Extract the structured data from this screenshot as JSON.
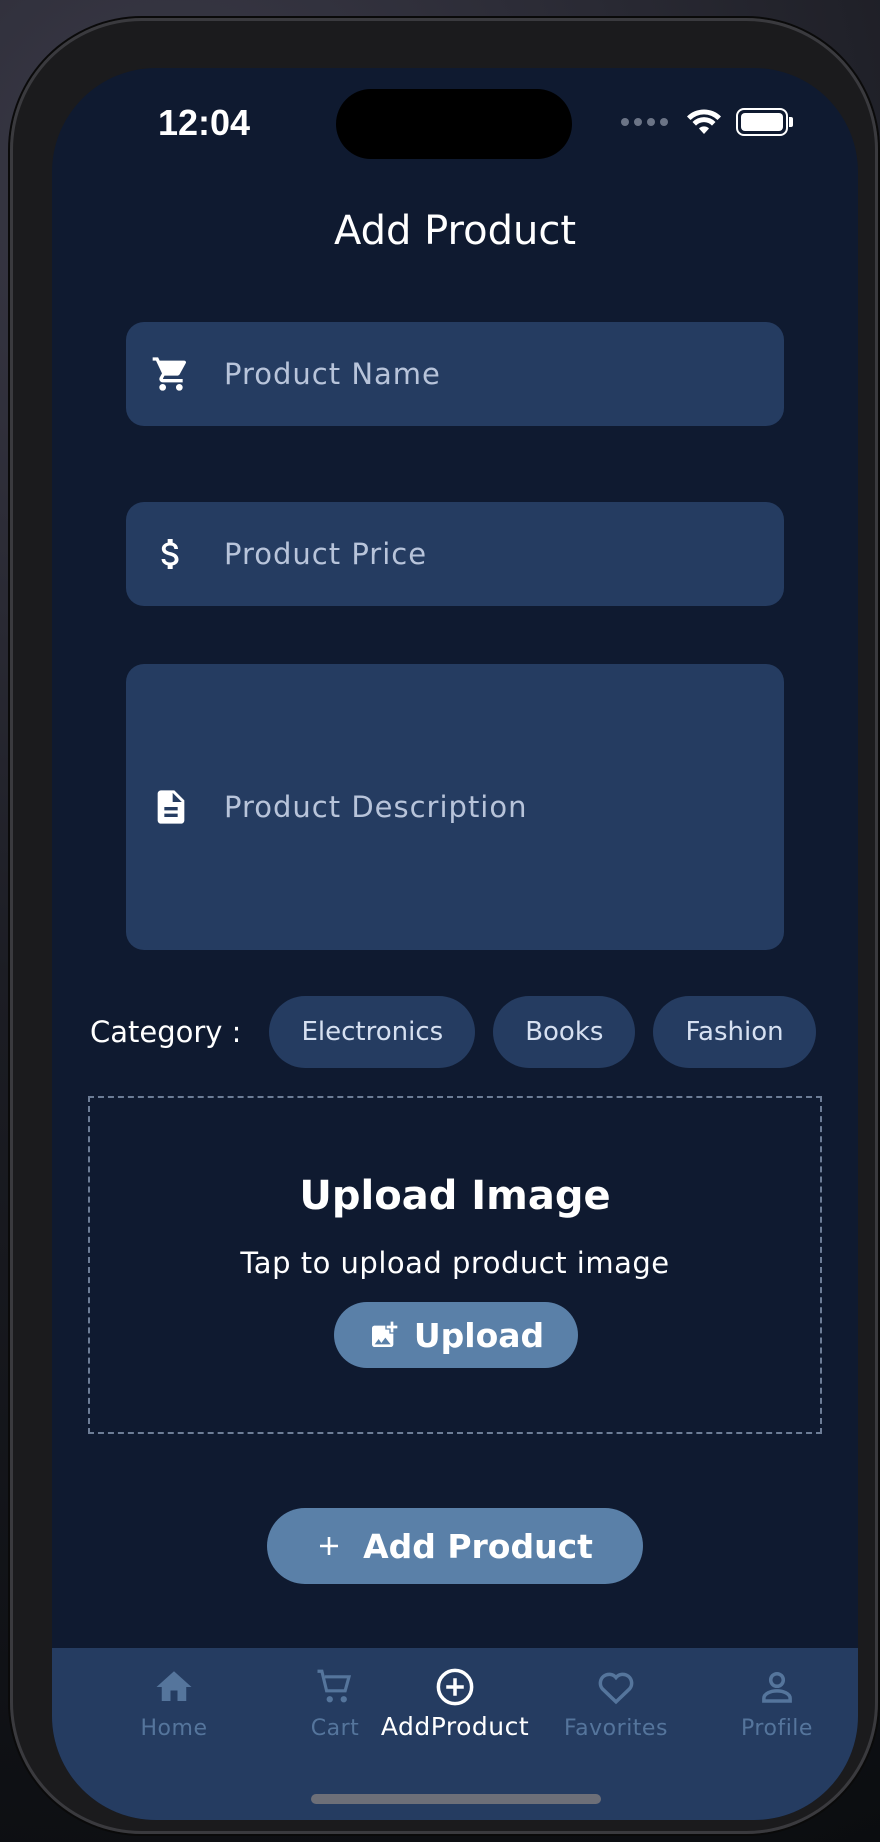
{
  "status_bar": {
    "time": "12:04"
  },
  "page": {
    "title": "Add Product"
  },
  "form": {
    "name_placeholder": "Product Name",
    "price_placeholder": "Product Price",
    "description_placeholder": "Product Description"
  },
  "category": {
    "label": "Category :",
    "options": [
      "Electronics",
      "Books",
      "Fashion"
    ]
  },
  "upload": {
    "title": "Upload Image",
    "subtitle": "Tap to upload product image",
    "button_label": "Upload"
  },
  "submit": {
    "label": "Add Product"
  },
  "bottom_nav": {
    "items": [
      {
        "label": "Home",
        "icon": "home-icon"
      },
      {
        "label": "Cart",
        "icon": "cart-icon"
      },
      {
        "label": "AddProduct",
        "icon": "add-circle-icon"
      },
      {
        "label": "Favorites",
        "icon": "heart-icon"
      },
      {
        "label": "Profile",
        "icon": "person-icon"
      }
    ],
    "active_index": 2
  },
  "colors": {
    "background": "#0f1a30",
    "field": "#253c61",
    "accent": "#5a80a8",
    "nav_inactive": "#55759c"
  }
}
